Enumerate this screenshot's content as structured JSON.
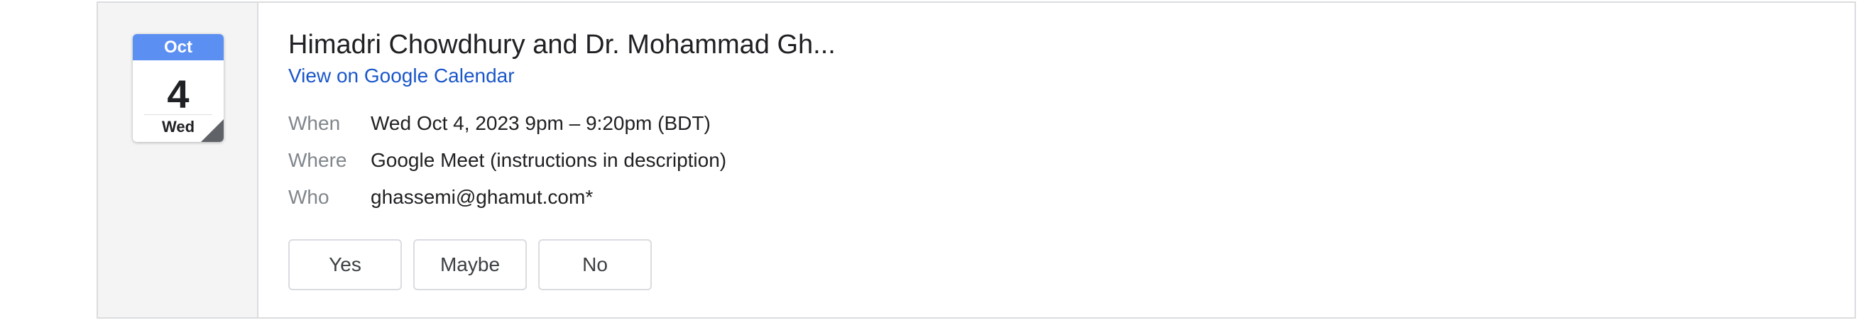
{
  "date_icon": {
    "month": "Oct",
    "day": "4",
    "weekday": "Wed"
  },
  "event": {
    "title": "Himadri Chowdhury and Dr. Mohammad Gh...",
    "calendar_link": "View on Google Calendar",
    "details": {
      "when_label": "When",
      "when_value": "Wed Oct 4, 2023 9pm – 9:20pm (BDT)",
      "where_label": "Where",
      "where_value": "Google Meet (instructions in description)",
      "who_label": "Who",
      "who_value": "ghassemi@ghamut.com*"
    }
  },
  "rsvp": {
    "yes_label": "Yes",
    "maybe_label": "Maybe",
    "no_label": "No"
  },
  "colors": {
    "month_header": "#5b8ff2",
    "link": "#1a56c9",
    "label": "#80868b",
    "text": "#202124",
    "left_pane_bg": "#f4f4f4"
  }
}
